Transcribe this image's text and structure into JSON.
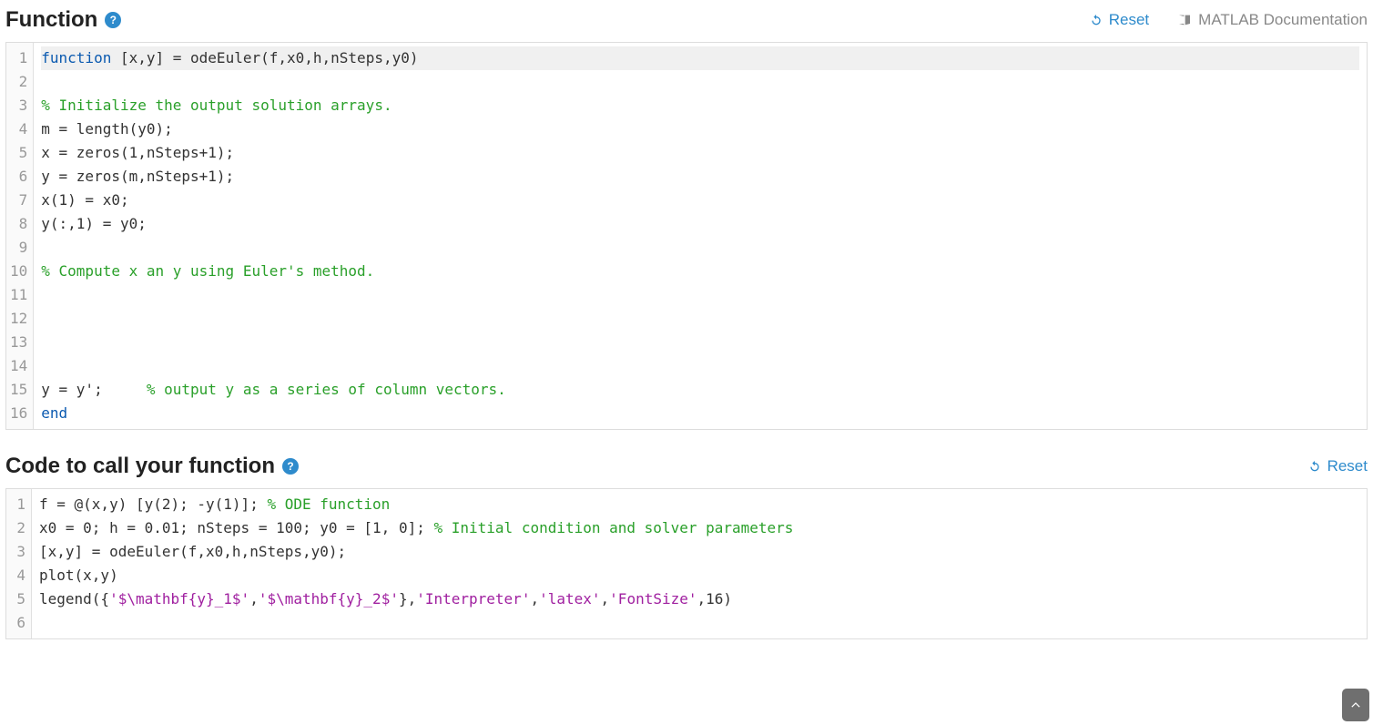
{
  "sections": {
    "function": {
      "title": "Function",
      "toolbar": {
        "reset": "Reset",
        "docs": "MATLAB Documentation"
      }
    },
    "call": {
      "title": "Code to call your function",
      "toolbar": {
        "reset": "Reset"
      }
    }
  },
  "editor_function": {
    "lines": [
      {
        "n": 1,
        "highlighted": true,
        "tokens": [
          {
            "t": "function ",
            "c": "kw"
          },
          {
            "t": "[x,y] = odeEuler(f,x0,h,nSteps,y0)",
            "c": ""
          }
        ]
      },
      {
        "n": 2,
        "tokens": []
      },
      {
        "n": 3,
        "tokens": [
          {
            "t": "% Initialize the output solution arrays.",
            "c": "cm"
          }
        ]
      },
      {
        "n": 4,
        "tokens": [
          {
            "t": "m = length(y0);",
            "c": ""
          }
        ]
      },
      {
        "n": 5,
        "tokens": [
          {
            "t": "x = zeros(1,nSteps+1);",
            "c": ""
          }
        ]
      },
      {
        "n": 6,
        "tokens": [
          {
            "t": "y = zeros(m,nSteps+1);",
            "c": ""
          }
        ]
      },
      {
        "n": 7,
        "tokens": [
          {
            "t": "x(1) = x0;",
            "c": ""
          }
        ]
      },
      {
        "n": 8,
        "tokens": [
          {
            "t": "y(:,1) = y0;",
            "c": ""
          }
        ]
      },
      {
        "n": 9,
        "tokens": []
      },
      {
        "n": 10,
        "tokens": [
          {
            "t": "% Compute x an y using Euler's method.",
            "c": "cm"
          }
        ]
      },
      {
        "n": 11,
        "tokens": []
      },
      {
        "n": 12,
        "tokens": []
      },
      {
        "n": 13,
        "tokens": []
      },
      {
        "n": 14,
        "tokens": []
      },
      {
        "n": 15,
        "tokens": [
          {
            "t": "y = y';     ",
            "c": ""
          },
          {
            "t": "% output y as a series of column vectors.",
            "c": "cm"
          }
        ]
      },
      {
        "n": 16,
        "tokens": [
          {
            "t": "end",
            "c": "kw"
          }
        ]
      }
    ]
  },
  "editor_call": {
    "lines": [
      {
        "n": 1,
        "tokens": [
          {
            "t": "f = @(x,y) [y(2); -y(1)]; ",
            "c": ""
          },
          {
            "t": "% ODE function",
            "c": "cm"
          }
        ]
      },
      {
        "n": 2,
        "tokens": [
          {
            "t": "x0 = 0; h = 0.01; nSteps = 100; y0 = [1, 0]; ",
            "c": ""
          },
          {
            "t": "% Initial condition and solver parameters",
            "c": "cm"
          }
        ]
      },
      {
        "n": 3,
        "tokens": [
          {
            "t": "[x,y] = odeEuler(f,x0,h,nSteps,y0);",
            "c": ""
          }
        ]
      },
      {
        "n": 4,
        "tokens": [
          {
            "t": "plot(x,y)",
            "c": ""
          }
        ]
      },
      {
        "n": 5,
        "tokens": [
          {
            "t": "legend({",
            "c": ""
          },
          {
            "t": "'$\\mathbf{y}_1$'",
            "c": "st"
          },
          {
            "t": ",",
            "c": ""
          },
          {
            "t": "'$\\mathbf{y}_2$'",
            "c": "st"
          },
          {
            "t": "},",
            "c": ""
          },
          {
            "t": "'Interpreter'",
            "c": "st"
          },
          {
            "t": ",",
            "c": ""
          },
          {
            "t": "'latex'",
            "c": "st"
          },
          {
            "t": ",",
            "c": ""
          },
          {
            "t": "'FontSize'",
            "c": "st"
          },
          {
            "t": ",16)",
            "c": ""
          }
        ]
      },
      {
        "n": 6,
        "tokens": []
      }
    ]
  }
}
